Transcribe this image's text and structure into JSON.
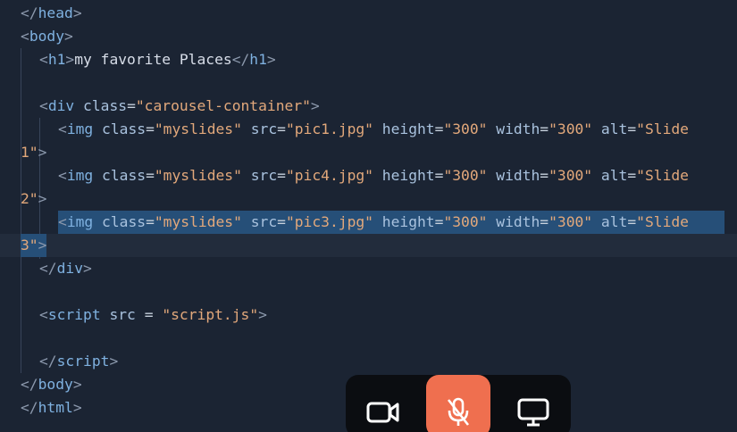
{
  "editor": {
    "lines": [
      {
        "id": "close-head",
        "tokens": [
          [
            "br",
            "</"
          ],
          [
            "tag",
            "head"
          ],
          [
            "br",
            ">"
          ]
        ]
      },
      {
        "id": "open-body",
        "tokens": [
          [
            "br",
            "<"
          ],
          [
            "tag",
            "body"
          ],
          [
            "br",
            ">"
          ]
        ]
      },
      {
        "id": "h1",
        "tokens": [
          [
            "br",
            "<"
          ],
          [
            "tag",
            "h1"
          ],
          [
            "br",
            ">"
          ],
          [
            "plain",
            "my favorite Places"
          ],
          [
            "br",
            "</"
          ],
          [
            "tag",
            "h1"
          ],
          [
            "br",
            ">"
          ]
        ]
      },
      {
        "id": "blank-1",
        "tokens": []
      },
      {
        "id": "open-div",
        "tokens": [
          [
            "br",
            "<"
          ],
          [
            "tag",
            "div"
          ],
          [
            "plain",
            " "
          ],
          [
            "attr",
            "class"
          ],
          [
            "eq",
            "="
          ],
          [
            "str",
            "\"carousel-container\""
          ],
          [
            "br",
            ">"
          ]
        ]
      },
      {
        "id": "img1-a",
        "tokens": [
          [
            "br",
            "<"
          ],
          [
            "tag",
            "img"
          ],
          [
            "plain",
            " "
          ],
          [
            "attr",
            "class"
          ],
          [
            "eq",
            "="
          ],
          [
            "str",
            "\"myslides\""
          ],
          [
            "plain",
            " "
          ],
          [
            "attr",
            "src"
          ],
          [
            "eq",
            "="
          ],
          [
            "str",
            "\"pic1.jpg\""
          ],
          [
            "plain",
            " "
          ],
          [
            "attr",
            "height"
          ],
          [
            "eq",
            "="
          ],
          [
            "str",
            "\"300\""
          ],
          [
            "plain",
            " "
          ],
          [
            "attr",
            "width"
          ],
          [
            "eq",
            "="
          ],
          [
            "str",
            "\"300\""
          ],
          [
            "plain",
            " "
          ],
          [
            "attr",
            "alt"
          ],
          [
            "eq",
            "="
          ],
          [
            "str",
            "\"Slide"
          ]
        ]
      },
      {
        "id": "img1-b",
        "tokens": [
          [
            "str",
            "1\""
          ],
          [
            "br",
            ">"
          ]
        ]
      },
      {
        "id": "img2-a",
        "tokens": [
          [
            "br",
            "<"
          ],
          [
            "tag",
            "img"
          ],
          [
            "plain",
            " "
          ],
          [
            "attr",
            "class"
          ],
          [
            "eq",
            "="
          ],
          [
            "str",
            "\"myslides\""
          ],
          [
            "plain",
            " "
          ],
          [
            "attr",
            "src"
          ],
          [
            "eq",
            "="
          ],
          [
            "str",
            "\"pic4.jpg\""
          ],
          [
            "plain",
            " "
          ],
          [
            "attr",
            "height"
          ],
          [
            "eq",
            "="
          ],
          [
            "str",
            "\"300\""
          ],
          [
            "plain",
            " "
          ],
          [
            "attr",
            "width"
          ],
          [
            "eq",
            "="
          ],
          [
            "str",
            "\"300\""
          ],
          [
            "plain",
            " "
          ],
          [
            "attr",
            "alt"
          ],
          [
            "eq",
            "="
          ],
          [
            "str",
            "\"Slide"
          ]
        ]
      },
      {
        "id": "img2-b",
        "tokens": [
          [
            "str",
            "2\""
          ],
          [
            "br",
            ">"
          ]
        ]
      },
      {
        "id": "img3-a",
        "tokens": [
          [
            "br",
            "<"
          ],
          [
            "tag",
            "img"
          ],
          [
            "plain",
            " "
          ],
          [
            "attr",
            "class"
          ],
          [
            "eq",
            "="
          ],
          [
            "str",
            "\"myslides\""
          ],
          [
            "plain",
            " "
          ],
          [
            "attr",
            "src"
          ],
          [
            "eq",
            "="
          ],
          [
            "str",
            "\"pic3.jpg\""
          ],
          [
            "plain",
            " "
          ],
          [
            "attr",
            "height"
          ],
          [
            "eq",
            "="
          ],
          [
            "str",
            "\"300\""
          ],
          [
            "plain",
            " "
          ],
          [
            "attr",
            "width"
          ],
          [
            "eq",
            "="
          ],
          [
            "str",
            "\"300\""
          ],
          [
            "plain",
            " "
          ],
          [
            "attr",
            "alt"
          ],
          [
            "eq",
            "="
          ],
          [
            "str",
            "\"Slide"
          ]
        ]
      },
      {
        "id": "img3-b",
        "tokens": [
          [
            "str",
            "3\""
          ],
          [
            "br",
            ">"
          ]
        ]
      },
      {
        "id": "close-div",
        "tokens": [
          [
            "br",
            "</"
          ],
          [
            "tag",
            "div"
          ],
          [
            "br",
            ">"
          ]
        ]
      },
      {
        "id": "blank-2",
        "tokens": []
      },
      {
        "id": "open-script",
        "tokens": [
          [
            "br",
            "<"
          ],
          [
            "tag",
            "script"
          ],
          [
            "plain",
            " "
          ],
          [
            "attr",
            "src"
          ],
          [
            "plain",
            " "
          ],
          [
            "eq",
            "="
          ],
          [
            "plain",
            " "
          ],
          [
            "str",
            "\"script.js\""
          ],
          [
            "br",
            ">"
          ]
        ]
      },
      {
        "id": "blank-3",
        "tokens": []
      },
      {
        "id": "close-script",
        "tokens": [
          [
            "br",
            "</"
          ],
          [
            "tag",
            "script"
          ],
          [
            "br",
            ">"
          ]
        ]
      },
      {
        "id": "close-body",
        "tokens": [
          [
            "br",
            "</"
          ],
          [
            "tag",
            "body"
          ],
          [
            "br",
            ">"
          ]
        ]
      },
      {
        "id": "close-html",
        "tokens": [
          [
            "br",
            "</"
          ],
          [
            "tag",
            "html"
          ],
          [
            "br",
            ">"
          ]
        ]
      }
    ],
    "selected_lines": [
      "img3-a",
      "img3-b"
    ]
  },
  "call_controls": {
    "camera": {
      "icon": "video-camera-icon"
    },
    "microphone": {
      "icon": "microphone-muted-icon",
      "state": "muted",
      "color": "#ef6f4f"
    },
    "screen_share": {
      "icon": "monitor-icon"
    }
  }
}
